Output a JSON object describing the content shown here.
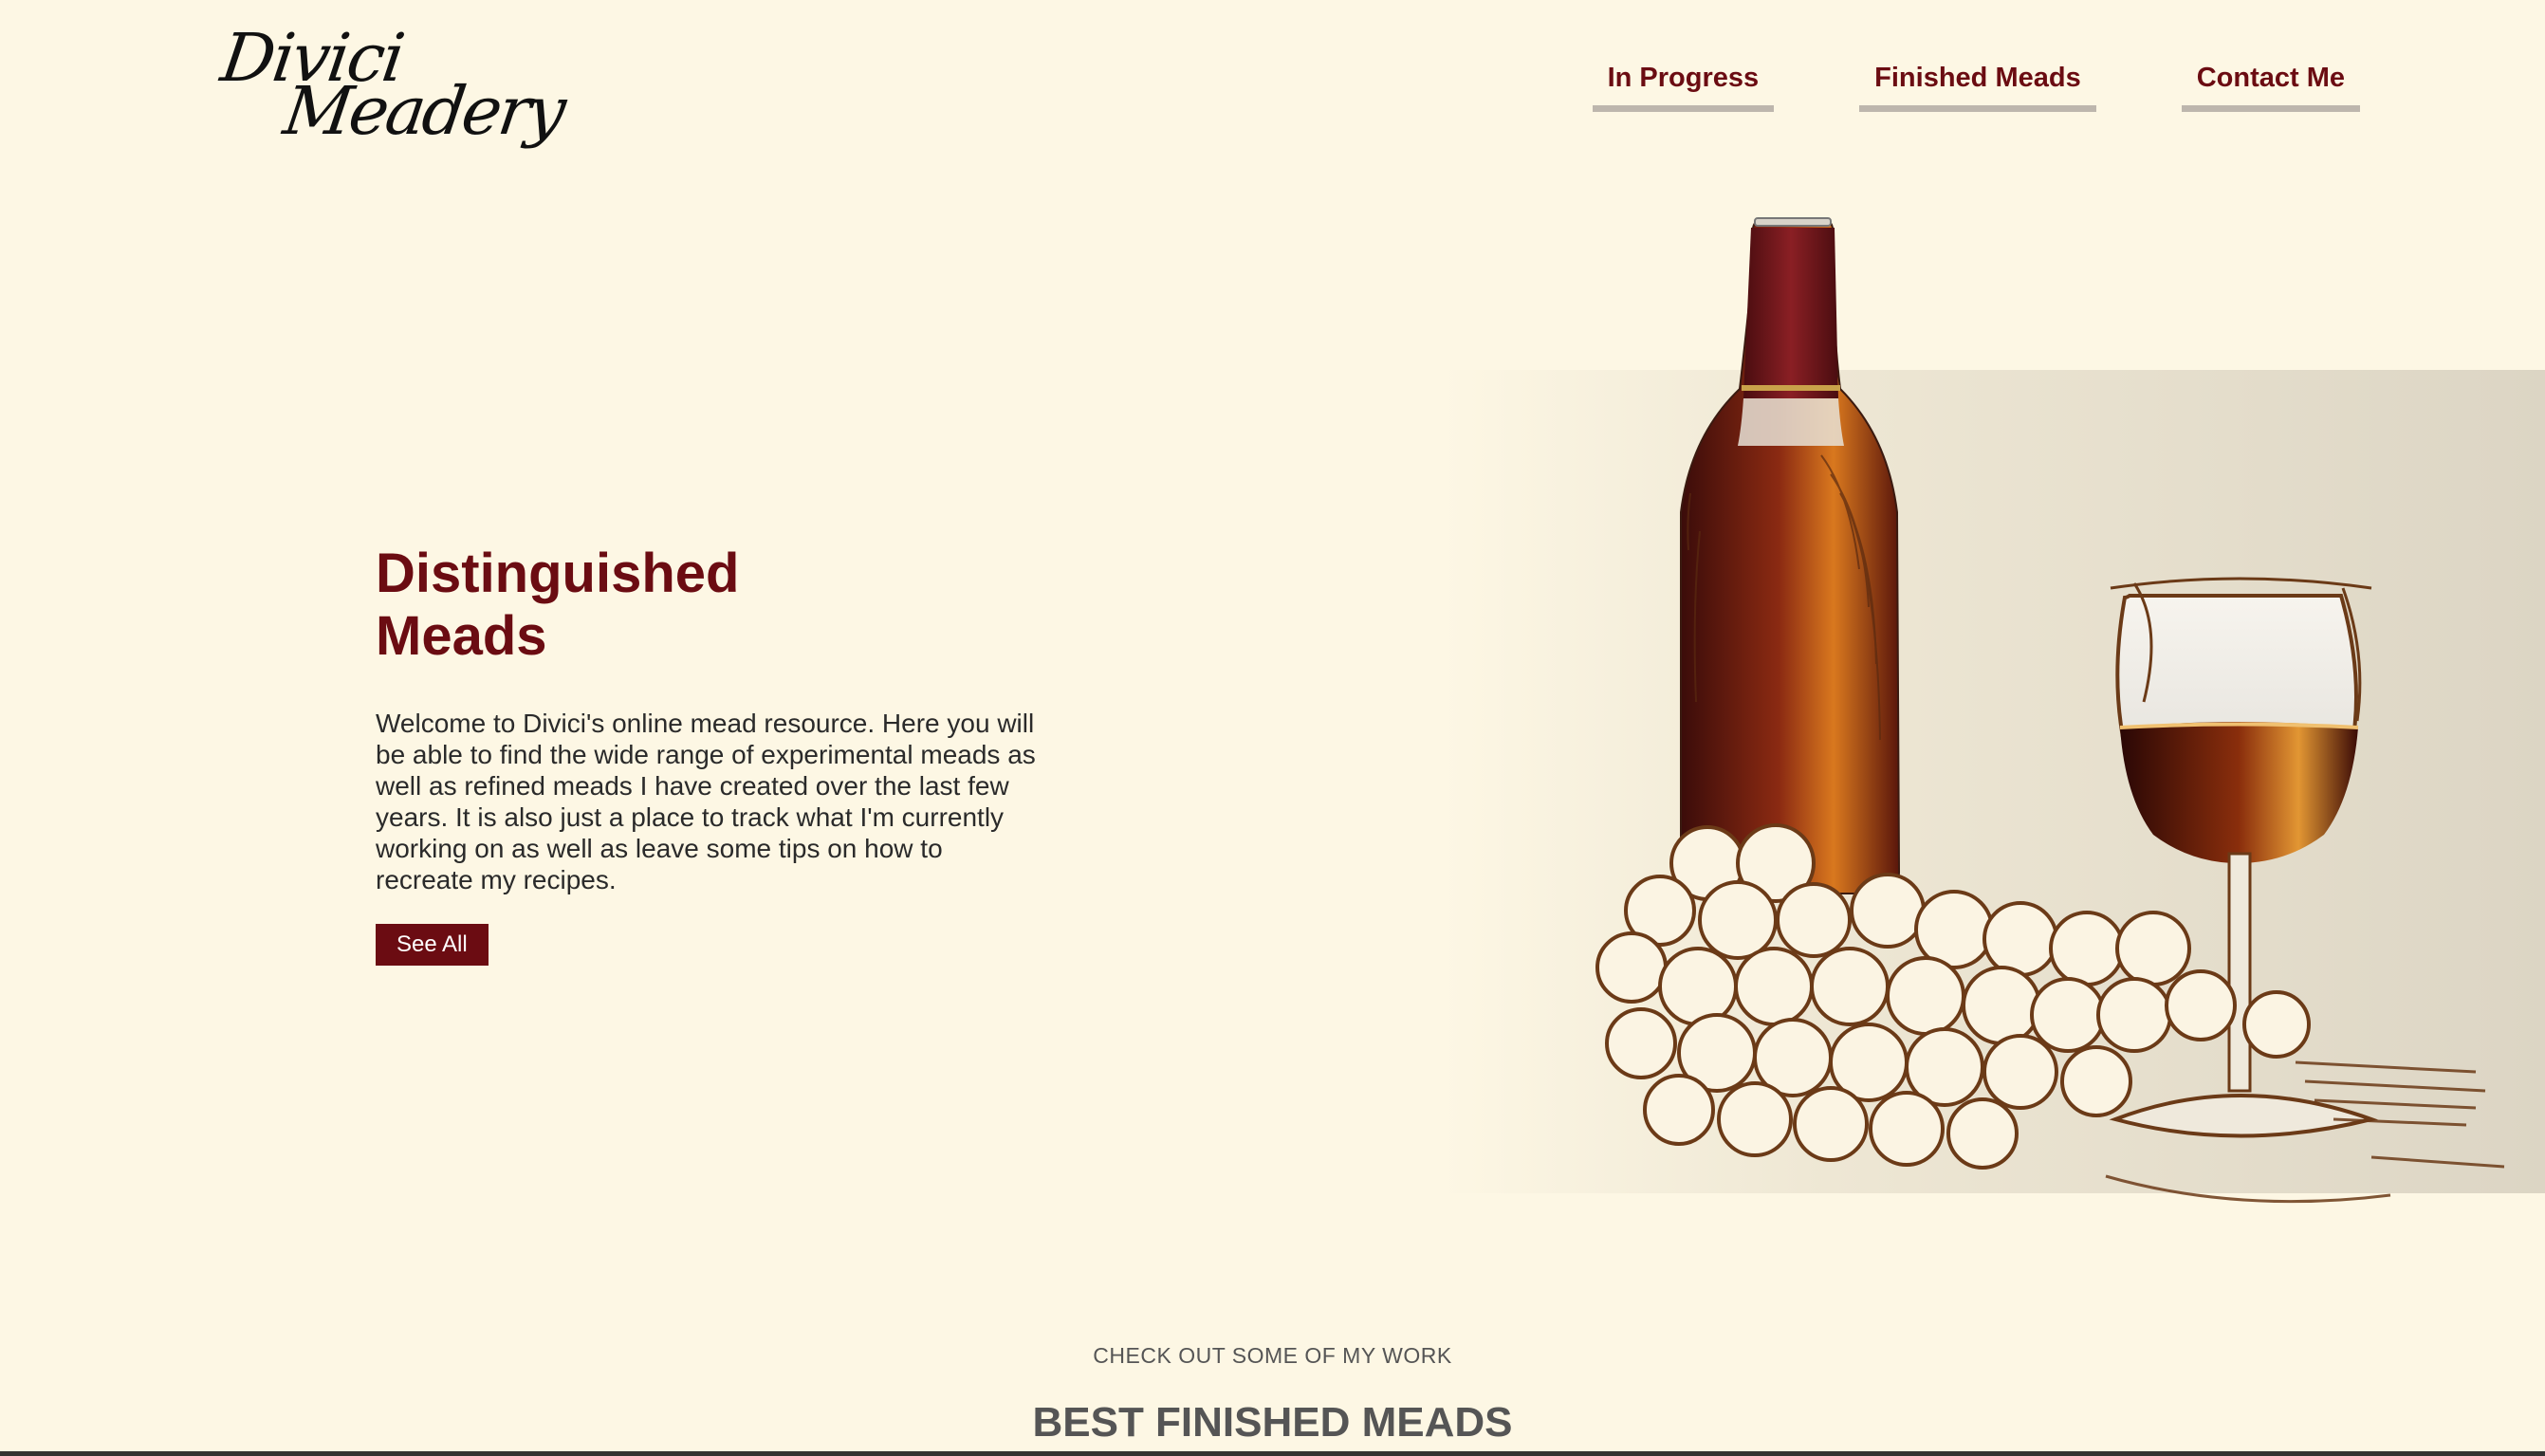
{
  "logo": {
    "line1": "Divici",
    "line2": "Meadery"
  },
  "nav": {
    "items": [
      {
        "label": "In Progress"
      },
      {
        "label": "Finished Meads"
      },
      {
        "label": "Contact Me"
      }
    ]
  },
  "hero": {
    "title": "Distinguished Meads",
    "description": "Welcome to Divici's online mead resource. Here you will be able to find the wide range of experimental meads as well as refined meads I have created over the last few years. It is also just a place to track what I'm currently working on as well as leave some tips on how to recreate my recipes.",
    "button_label": "See All"
  },
  "section": {
    "subheading": "CHECK OUT SOME OF MY WORK",
    "title": "BEST FINISHED MEADS"
  },
  "colors": {
    "background": "#fdf7e4",
    "accent": "#6b0c12",
    "nav_underline": "#bdb6ad"
  }
}
